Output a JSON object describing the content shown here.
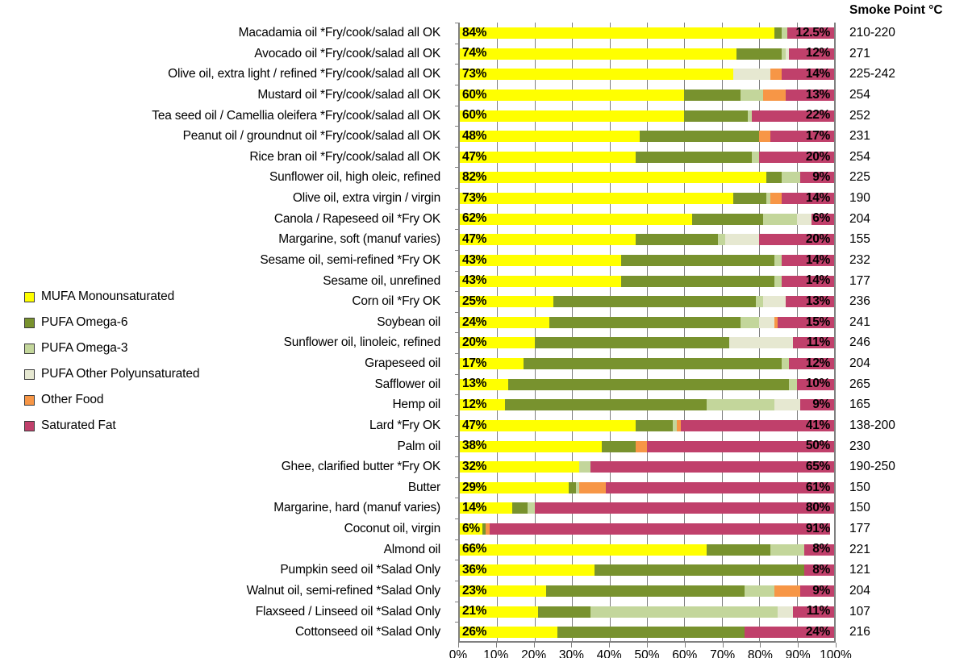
{
  "chart_data": {
    "type": "bar",
    "orientation": "horizontal",
    "stacked": true,
    "title": "",
    "xlabel": "",
    "ylabel": "",
    "xlim": [
      0,
      100
    ],
    "xticks": [
      "0%",
      "10%",
      "20%",
      "30%",
      "40%",
      "50%",
      "60%",
      "70%",
      "80%",
      "90%",
      "100%"
    ],
    "grid": "vertical",
    "legend_position": "left",
    "series": [
      {
        "name": "MUFA Monounsaturated",
        "color": "#FFFF00"
      },
      {
        "name": "PUFA Omega-6",
        "color": "#78922E"
      },
      {
        "name": "PUFA Omega-3",
        "color": "#C3D69B"
      },
      {
        "name": "PUFA Other Polyunsaturated",
        "color": "#E6E8D1"
      },
      {
        "name": "Other Food",
        "color": "#F79646"
      },
      {
        "name": "Saturated Fat",
        "color": "#C0406B"
      }
    ],
    "extra_column_header": "Smoke Point °C",
    "categories": [
      "Macadamia oil *Fry/cook/salad all OK",
      "Avocado oil *Fry/cook/salad all OK",
      "Olive oil, extra light / refined *Fry/cook/salad all OK",
      "Mustard oil *Fry/cook/salad all OK",
      "Tea seed oil / Camellia oleifera *Fry/cook/salad all OK",
      "Peanut oil / groundnut oil *Fry/cook/salad all OK",
      "Rice bran oil *Fry/cook/salad all OK",
      "Sunflower oil, high oleic, refined",
      "Olive oil, extra virgin / virgin",
      "Canola / Rapeseed oil *Fry OK",
      "Margarine, soft (manuf varies)",
      "Sesame oil, semi-refined *Fry OK",
      "Sesame oil, unrefined",
      "Corn oil *Fry OK",
      "Soybean oil",
      "Sunflower oil, linoleic, refined",
      "Grapeseed oil",
      "Safflower oil",
      "Hemp oil",
      "Lard *Fry OK",
      "Palm oil",
      "Ghee, clarified butter *Fry OK",
      "Butter",
      "Margarine, hard (manuf varies)",
      "Coconut oil, virgin",
      "Almond oil",
      "Pumpkin seed oil *Salad Only",
      "Walnut oil, semi-refined *Salad Only",
      "Flaxseed / Linseed oil *Salad Only",
      "Cottonseed oil *Salad Only"
    ],
    "rows": [
      {
        "category": "Macadamia oil *Fry/cook/salad all OK",
        "mufa": 84,
        "omega6": 2,
        "omega3": 1.5,
        "other_pufa": 0,
        "other_food": 0,
        "saturated": 12.5,
        "left_label": "84%",
        "right_label": "12.5%",
        "smoke_point": "210-220"
      },
      {
        "category": "Avocado oil *Fry/cook/salad all OK",
        "mufa": 74,
        "omega6": 12,
        "omega3": 1,
        "other_pufa": 1,
        "other_food": 0,
        "saturated": 12,
        "left_label": "74%",
        "right_label": "12%",
        "smoke_point": "271"
      },
      {
        "category": "Olive oil, extra light / refined *Fry/cook/salad all OK",
        "mufa": 73,
        "omega6": 0,
        "omega3": 0,
        "other_pufa": 10,
        "other_food": 3,
        "saturated": 14,
        "left_label": "73%",
        "right_label": "14%",
        "smoke_point": "225-242"
      },
      {
        "category": "Mustard oil *Fry/cook/salad all OK",
        "mufa": 60,
        "omega6": 15,
        "omega3": 6,
        "other_pufa": 0,
        "other_food": 6,
        "saturated": 13,
        "left_label": "60%",
        "right_label": "13%",
        "smoke_point": "254"
      },
      {
        "category": "Tea seed oil / Camellia oleifera *Fry/cook/salad all OK",
        "mufa": 60,
        "omega6": 17,
        "omega3": 1,
        "other_pufa": 0,
        "other_food": 0,
        "saturated": 22,
        "left_label": "60%",
        "right_label": "22%",
        "smoke_point": "252"
      },
      {
        "category": "Peanut oil / groundnut oil *Fry/cook/salad all OK",
        "mufa": 48,
        "omega6": 32,
        "omega3": 0,
        "other_pufa": 0,
        "other_food": 3,
        "saturated": 17,
        "left_label": "48%",
        "right_label": "17%",
        "smoke_point": "231"
      },
      {
        "category": "Rice bran oil *Fry/cook/salad all OK",
        "mufa": 47,
        "omega6": 31,
        "omega3": 2,
        "other_pufa": 0,
        "other_food": 0,
        "saturated": 20,
        "left_label": "47%",
        "right_label": "20%",
        "smoke_point": "254"
      },
      {
        "category": "Sunflower oil, high oleic, refined",
        "mufa": 82,
        "omega6": 4,
        "omega3": 5,
        "other_pufa": 0,
        "other_food": 0,
        "saturated": 9,
        "left_label": "82%",
        "right_label": "9%",
        "smoke_point": "225"
      },
      {
        "category": "Olive oil, extra virgin / virgin",
        "mufa": 73,
        "omega6": 9,
        "omega3": 1,
        "other_pufa": 0,
        "other_food": 3,
        "saturated": 14,
        "left_label": "73%",
        "right_label": "14%",
        "smoke_point": "190"
      },
      {
        "category": "Canola / Rapeseed oil *Fry OK",
        "mufa": 62,
        "omega6": 19,
        "omega3": 9,
        "other_pufa": 4,
        "other_food": 0,
        "saturated": 6,
        "left_label": "62%",
        "right_label": "6%",
        "smoke_point": "204"
      },
      {
        "category": "Margarine, soft (manuf varies)",
        "mufa": 47,
        "omega6": 22,
        "omega3": 2,
        "other_pufa": 9,
        "other_food": 0,
        "saturated": 20,
        "left_label": "47%",
        "right_label": "20%",
        "smoke_point": "155"
      },
      {
        "category": "Sesame oil, semi-refined *Fry OK",
        "mufa": 43,
        "omega6": 41,
        "omega3": 2,
        "other_pufa": 0,
        "other_food": 0,
        "saturated": 14,
        "left_label": "43%",
        "right_label": "14%",
        "smoke_point": "232"
      },
      {
        "category": "Sesame oil, unrefined",
        "mufa": 43,
        "omega6": 41,
        "omega3": 2,
        "other_pufa": 0,
        "other_food": 0,
        "saturated": 14,
        "left_label": "43%",
        "right_label": "14%",
        "smoke_point": "177"
      },
      {
        "category": "Corn oil *Fry OK",
        "mufa": 25,
        "omega6": 54,
        "omega3": 2,
        "other_pufa": 6,
        "other_food": 0,
        "saturated": 13,
        "left_label": "25%",
        "right_label": "13%",
        "smoke_point": "236"
      },
      {
        "category": "Soybean oil",
        "mufa": 24,
        "omega6": 51,
        "omega3": 5,
        "other_pufa": 4,
        "other_food": 1,
        "saturated": 15,
        "left_label": "24%",
        "right_label": "15%",
        "smoke_point": "241"
      },
      {
        "category": "Sunflower oil, linoleic, refined",
        "mufa": 20,
        "omega6": 52,
        "omega3": 0,
        "other_pufa": 17,
        "other_food": 0,
        "saturated": 11,
        "left_label": "20%",
        "right_label": "11%",
        "smoke_point": "246"
      },
      {
        "category": "Grapeseed oil",
        "mufa": 17,
        "omega6": 69,
        "omega3": 2,
        "other_pufa": 0,
        "other_food": 0,
        "saturated": 12,
        "left_label": "17%",
        "right_label": "12%",
        "smoke_point": "204"
      },
      {
        "category": "Safflower oil",
        "mufa": 13,
        "omega6": 75,
        "omega3": 2,
        "other_pufa": 0,
        "other_food": 0,
        "saturated": 10,
        "left_label": "13%",
        "right_label": "10%",
        "smoke_point": "265"
      },
      {
        "category": "Hemp oil",
        "mufa": 12,
        "omega6": 54,
        "omega3": 18,
        "other_pufa": 7,
        "other_food": 0,
        "saturated": 9,
        "left_label": "12%",
        "right_label": "9%",
        "smoke_point": "165"
      },
      {
        "category": "Lard *Fry OK",
        "mufa": 47,
        "omega6": 10,
        "omega3": 1,
        "other_pufa": 0,
        "other_food": 1,
        "saturated": 41,
        "left_label": "47%",
        "right_label": "41%",
        "smoke_point": "138-200"
      },
      {
        "category": "Palm oil",
        "mufa": 38,
        "omega6": 9,
        "omega3": 0,
        "other_pufa": 0,
        "other_food": 3,
        "saturated": 50,
        "left_label": "38%",
        "right_label": "50%",
        "smoke_point": "230"
      },
      {
        "category": "Ghee, clarified butter *Fry OK",
        "mufa": 32,
        "omega6": 0,
        "omega3": 3,
        "other_pufa": 0,
        "other_food": 0,
        "saturated": 65,
        "left_label": "32%",
        "right_label": "65%",
        "smoke_point": "190-250"
      },
      {
        "category": "Butter",
        "mufa": 29,
        "omega6": 2,
        "omega3": 1,
        "other_pufa": 0,
        "other_food": 7,
        "saturated": 61,
        "left_label": "29%",
        "right_label": "61%",
        "smoke_point": "150"
      },
      {
        "category": "Margarine, hard (manuf varies)",
        "mufa": 14,
        "omega6": 4,
        "omega3": 2,
        "other_pufa": 0,
        "other_food": 0,
        "saturated": 80,
        "left_label": "14%",
        "right_label": "80%",
        "smoke_point": "150"
      },
      {
        "category": "Coconut oil, virgin",
        "mufa": 6,
        "omega6": 1,
        "omega3": 0,
        "other_pufa": 0,
        "other_food": 1,
        "saturated": 91,
        "left_label": "6%",
        "right_label": "91%",
        "smoke_point": "177"
      },
      {
        "category": "Almond oil",
        "mufa": 66,
        "omega6": 17,
        "omega3": 9,
        "other_pufa": 0,
        "other_food": 0,
        "saturated": 8,
        "left_label": "66%",
        "right_label": "8%",
        "smoke_point": "221"
      },
      {
        "category": "Pumpkin seed oil *Salad Only",
        "mufa": 36,
        "omega6": 56,
        "omega3": 0,
        "other_pufa": 0,
        "other_food": 0,
        "saturated": 8,
        "left_label": "36%",
        "right_label": "8%",
        "smoke_point": "121"
      },
      {
        "category": "Walnut oil, semi-refined *Salad Only",
        "mufa": 23,
        "omega6": 53,
        "omega3": 8,
        "other_pufa": 0,
        "other_food": 7,
        "saturated": 9,
        "left_label": "23%",
        "right_label": "9%",
        "smoke_point": "204"
      },
      {
        "category": "Flaxseed / Linseed oil *Salad Only",
        "mufa": 21,
        "omega6": 14,
        "omega3": 50,
        "other_pufa": 4,
        "other_food": 0,
        "saturated": 11,
        "left_label": "21%",
        "right_label": "11%",
        "smoke_point": "107"
      },
      {
        "category": "Cottonseed oil *Salad Only",
        "mufa": 26,
        "omega6": 50,
        "omega3": 0,
        "other_pufa": 0,
        "other_food": 0,
        "saturated": 24,
        "left_label": "26%",
        "right_label": "24%",
        "smoke_point": "216"
      }
    ]
  }
}
